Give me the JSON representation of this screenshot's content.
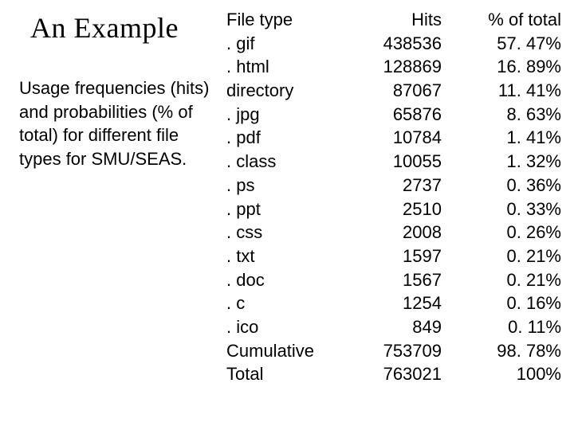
{
  "title": "An Example",
  "description": "Usage frequencies (hits) and probabilities (% of total) for different file types for SMU/SEAS.",
  "table": {
    "headers": {
      "type": "File type",
      "hits": "Hits",
      "pct": "% of total"
    },
    "rows": [
      {
        "type": ". gif",
        "hits": "438536",
        "pct": "57. 47%"
      },
      {
        "type": ". html",
        "hits": "128869",
        "pct": "16. 89%"
      },
      {
        "type": "directory",
        "hits": "87067",
        "pct": "11. 41%"
      },
      {
        "type": ". jpg",
        "hits": "65876",
        "pct": "8. 63%"
      },
      {
        "type": ". pdf",
        "hits": "10784",
        "pct": "1. 41%"
      },
      {
        "type": ". class",
        "hits": "10055",
        "pct": "1. 32%"
      },
      {
        "type": ". ps",
        "hits": "2737",
        "pct": "0. 36%"
      },
      {
        "type": ". ppt",
        "hits": "2510",
        "pct": "0. 33%"
      },
      {
        "type": ". css",
        "hits": "2008",
        "pct": "0. 26%"
      },
      {
        "type": ". txt",
        "hits": "1597",
        "pct": "0. 21%"
      },
      {
        "type": ". doc",
        "hits": "1567",
        "pct": "0. 21%"
      },
      {
        "type": ". c",
        "hits": "1254",
        "pct": "0. 16%"
      },
      {
        "type": ". ico",
        "hits": "849",
        "pct": "0. 11%"
      },
      {
        "type": "Cumulative",
        "hits": "753709",
        "pct": "98. 78%"
      },
      {
        "type": "Total",
        "hits": "763021",
        "pct": "100%"
      }
    ]
  },
  "chart_data": {
    "type": "table",
    "title": "An Example",
    "columns": [
      "File type",
      "Hits",
      "% of total"
    ],
    "rows": [
      [
        ".gif",
        438536,
        57.47
      ],
      [
        ".html",
        128869,
        16.89
      ],
      [
        "directory",
        87067,
        11.41
      ],
      [
        ".jpg",
        65876,
        8.63
      ],
      [
        ".pdf",
        10784,
        1.41
      ],
      [
        ".class",
        10055,
        1.32
      ],
      [
        ".ps",
        2737,
        0.36
      ],
      [
        ".ppt",
        2510,
        0.33
      ],
      [
        ".css",
        2008,
        0.26
      ],
      [
        ".txt",
        1597,
        0.21
      ],
      [
        ".doc",
        1567,
        0.21
      ],
      [
        ".c",
        1254,
        0.16
      ],
      [
        ".ico",
        849,
        0.11
      ],
      [
        "Cumulative",
        753709,
        98.78
      ],
      [
        "Total",
        763021,
        100
      ]
    ]
  }
}
